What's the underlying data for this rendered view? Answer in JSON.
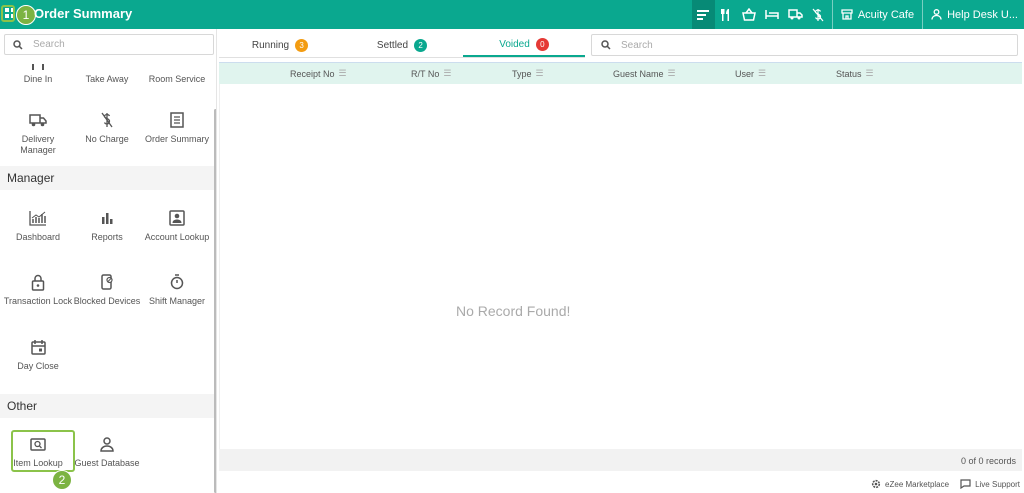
{
  "header": {
    "title": "Order Summary",
    "outlet": "Acuity Cafe",
    "user": "Help Desk U...",
    "icons": [
      "order-summary-icon",
      "dine-in-icon",
      "take-away-icon",
      "room-service-icon",
      "delivery-icon",
      "no-charge-icon"
    ]
  },
  "annotations": {
    "step1": "1",
    "step2": "2"
  },
  "sidebar": {
    "search_placeholder": "Search",
    "top_items": [
      {
        "label": "Dine In"
      },
      {
        "label": "Take Away"
      },
      {
        "label": "Room Service"
      },
      {
        "label": "Delivery Manager",
        "icon": "truck-icon"
      },
      {
        "label": "No Charge",
        "icon": "no-charge-icon"
      },
      {
        "label": "Order Summary",
        "icon": "document-icon"
      }
    ],
    "sections": [
      {
        "title": "Manager",
        "items": [
          {
            "label": "Dashboard",
            "icon": "dashboard-chart-icon"
          },
          {
            "label": "Reports",
            "icon": "bar-chart-icon"
          },
          {
            "label": "Account Lookup",
            "icon": "account-card-icon"
          },
          {
            "label": "Transaction Lock",
            "icon": "lock-icon"
          },
          {
            "label": "Blocked Devices",
            "icon": "blocked-device-icon"
          },
          {
            "label": "Shift Manager",
            "icon": "stopwatch-icon"
          },
          {
            "label": "Day Close",
            "icon": "calendar-icon"
          }
        ]
      },
      {
        "title": "Other",
        "items": [
          {
            "label": "Item Lookup",
            "icon": "item-search-icon"
          },
          {
            "label": "Guest Database",
            "icon": "person-icon"
          }
        ]
      }
    ]
  },
  "tabs": [
    {
      "label": "Running",
      "count": "3",
      "color": "#f39c12"
    },
    {
      "label": "Settled",
      "count": "2",
      "color": "#0aa88f"
    },
    {
      "label": "Voided",
      "count": "0",
      "color": "#e53935"
    }
  ],
  "main_search_placeholder": "Search",
  "table": {
    "columns": [
      "Receipt No",
      "R/T No",
      "Type",
      "Guest Name",
      "User",
      "Status"
    ],
    "empty_text": "No Record Found!",
    "footer": "0 of 0 records"
  },
  "footer_links": {
    "marketplace": "eZee Marketplace",
    "support": "Live Support"
  },
  "colors": {
    "accent": "#0aa88f",
    "highlight": "#8bc34a"
  }
}
